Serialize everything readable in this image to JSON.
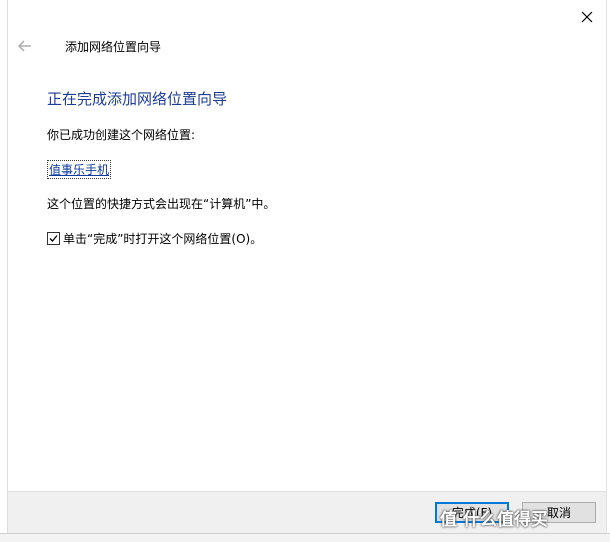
{
  "window": {
    "title": "添加网络位置向导"
  },
  "wizard": {
    "heading": "正在完成添加网络位置向导",
    "intro": "你已成功创建这个网络位置:",
    "location_name": "值事乐手机",
    "shortcut_note": "这个位置的快捷方式会出现在“计算机”中。",
    "open_on_finish": {
      "label": "单击“完成”时打开这个网络位置(O)。",
      "checked": true
    }
  },
  "buttons": {
    "finish_label": "完成(F)",
    "cancel_label": "取消"
  },
  "watermark": {
    "text": "值 什么值得买"
  },
  "colors": {
    "heading": "#1e3c96",
    "link": "#0b3a9c",
    "primary_border": "#0078d7",
    "footer_bg": "#f0f0f0"
  },
  "icons": {
    "close": "close-icon",
    "back": "back-arrow-icon",
    "check": "checkmark-icon"
  }
}
